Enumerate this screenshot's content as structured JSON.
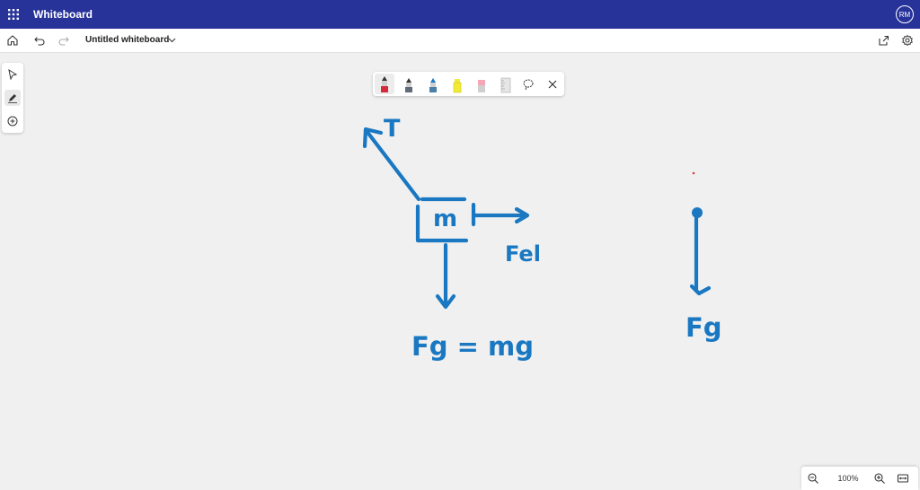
{
  "app": {
    "title": "Whiteboard",
    "user_initials": "RM"
  },
  "document": {
    "title": "Untitled whiteboard"
  },
  "zoom": {
    "level": "100%"
  },
  "drawing": {
    "label_tension": "T",
    "label_mass": "m",
    "label_elastic_force": "Fel",
    "label_gravity_equation": "Fg = mg",
    "label_gravity": "Fg"
  },
  "colors": {
    "titlebar": "#28339a",
    "ink": "#1a78c2",
    "canvas": "#f0f0f0"
  }
}
